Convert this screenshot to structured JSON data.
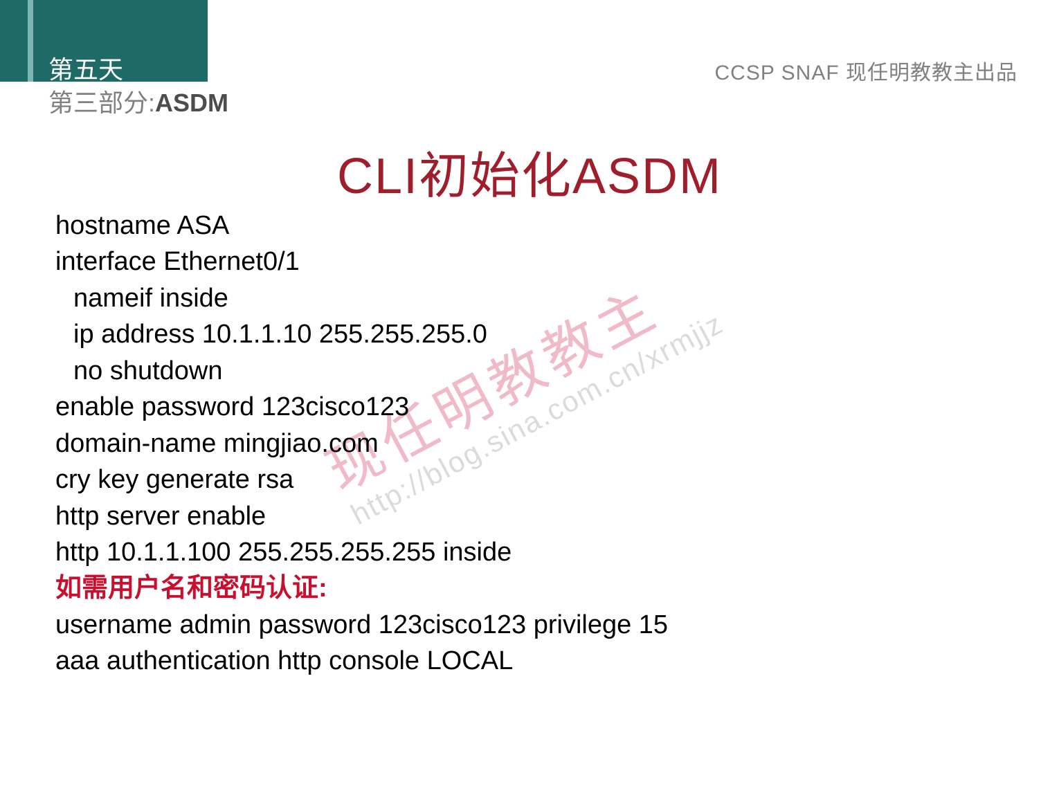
{
  "header": {
    "day_label": "第五天",
    "section_prefix": "第三部分:",
    "section_name": "ASDM",
    "course_tag": "CCSP SNAF  现任明教教主出品"
  },
  "title": "CLI初始化ASDM",
  "cli": {
    "l1": "hostname ASA",
    "l2": "interface Ethernet0/1",
    "l3": "nameif inside",
    "l4": "ip address 10.1.1.10 255.255.255.0",
    "l5": "no shutdown",
    "l6": "enable password 123cisco123",
    "l7": "domain-name mingjiao.com",
    "l8": "cry key generate rsa",
    "l9": "http server enable",
    "l10": "http 10.1.1.100 255.255.255.255 inside",
    "note": "如需用户名和密码认证:",
    "l11": "username admin password 123cisco123 privilege 15",
    "l12": "aaa authentication http console LOCAL"
  },
  "watermark": {
    "text_cn": "现任明教教主",
    "text_url": "http://blog.sina.com.cn/xrmjjz"
  }
}
